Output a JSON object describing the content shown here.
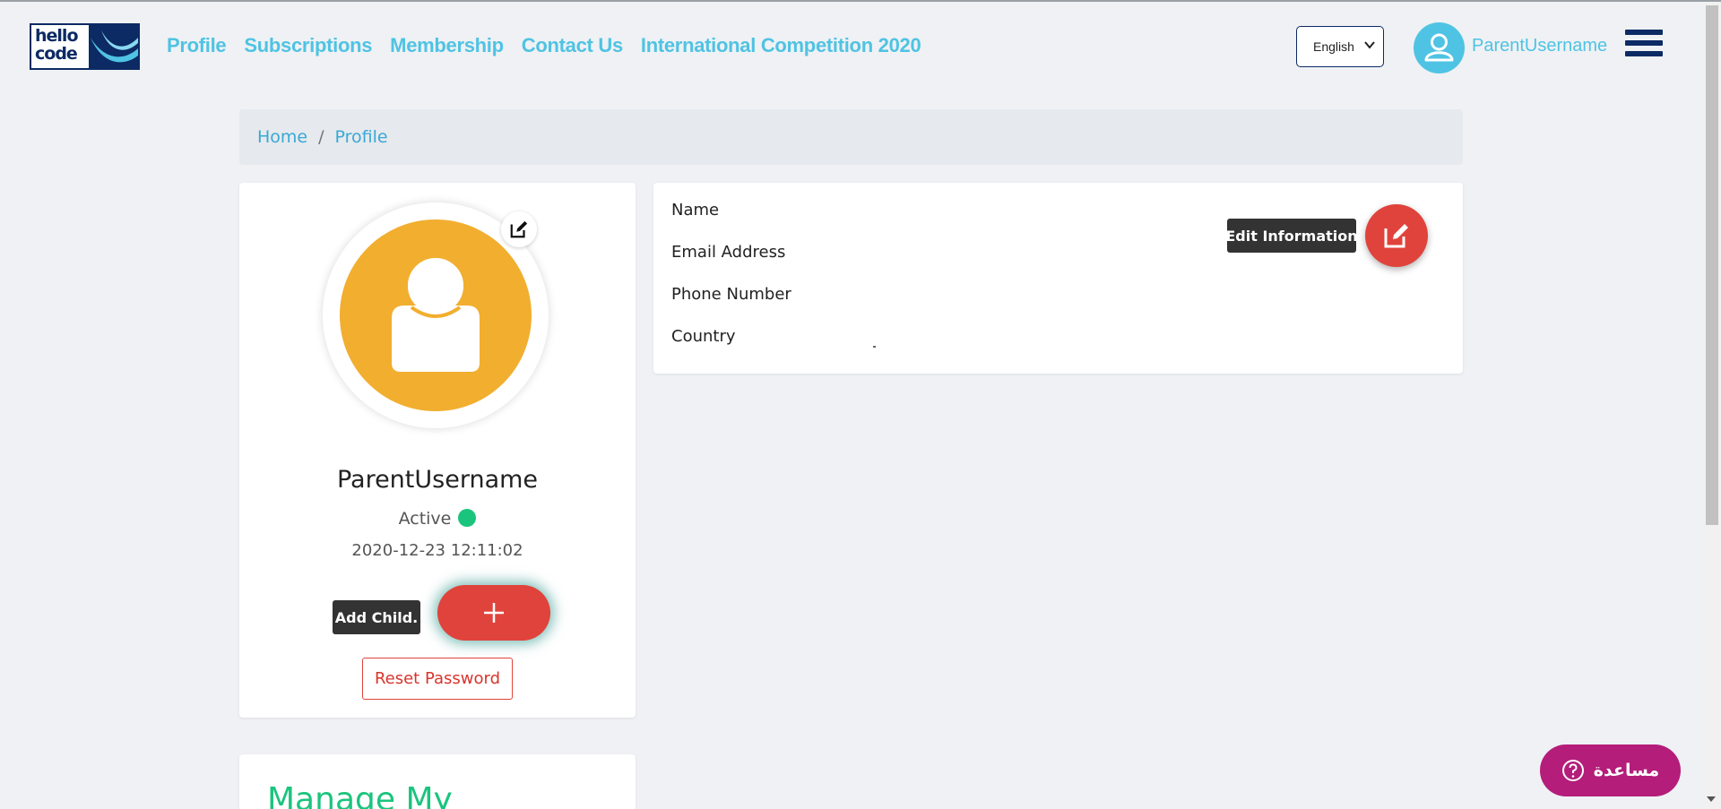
{
  "header": {
    "logo_text": "hello code",
    "nav": [
      {
        "label": "Profile"
      },
      {
        "label": "Subscriptions"
      },
      {
        "label": "Membership"
      },
      {
        "label": "Contact Us"
      },
      {
        "label": "International Competition 2020"
      }
    ],
    "language": {
      "selected": "English"
    },
    "username": "ParentUsername"
  },
  "breadcrumb": {
    "items": [
      "Home",
      "Profile"
    ],
    "separator": "/"
  },
  "profile": {
    "name": "ParentUsername",
    "status": "Active",
    "date": "2020-12-23 12:11:02",
    "add_child_tooltip": "Add Child.",
    "add_child_symbol": "+",
    "reset_password": "Reset Password"
  },
  "info": {
    "labels": [
      "Name",
      "Email Address",
      "Phone Number",
      "Country"
    ],
    "edit_tooltip": "Edit Information"
  },
  "manage": {
    "title": "Manage My"
  },
  "help": {
    "label": "مساعدة"
  },
  "colors": {
    "accent": "#4fc3e3",
    "navy": "#0c2a64",
    "danger": "#e0433b",
    "success": "#1bc47d",
    "avatar": "#f2ae2f",
    "help": "#b41d7a"
  },
  "icons": {
    "user": "user-icon",
    "edit": "edit-icon",
    "plus": "plus-icon",
    "menu": "hamburger-icon",
    "help": "question-circle-icon"
  }
}
